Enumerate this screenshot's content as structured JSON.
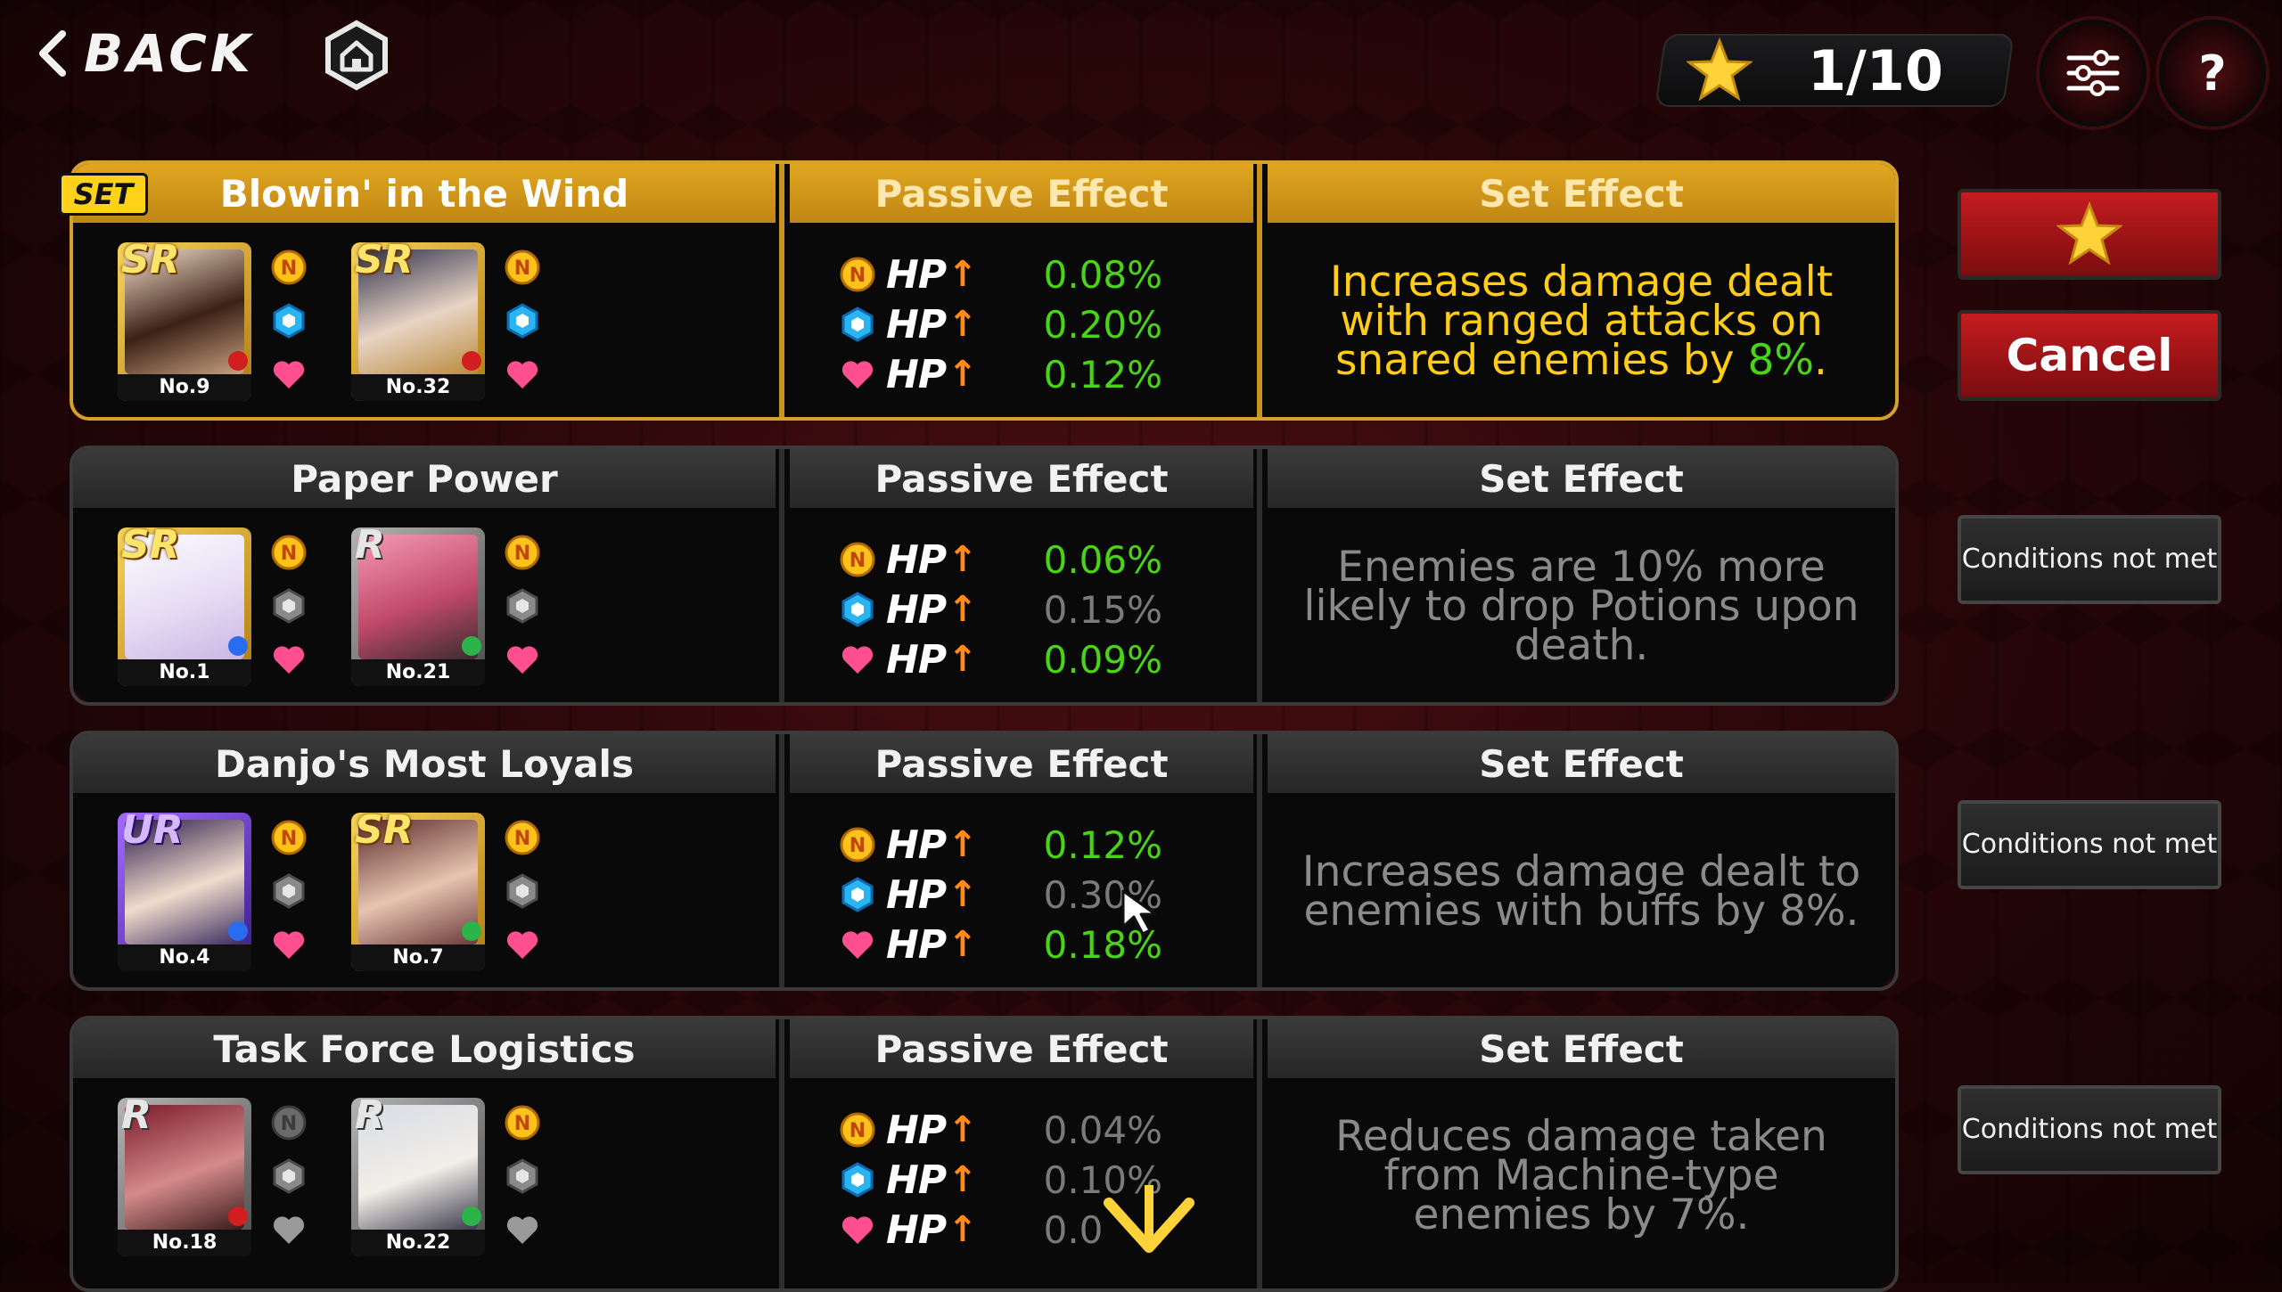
{
  "header": {
    "back_label": "BACK",
    "star_count": "1/10"
  },
  "side": {
    "cancel_label": "Cancel",
    "conditions_label": "Conditions not met"
  },
  "colors": {
    "accent_gold": "#d4a12a",
    "value_green": "#4ad418",
    "value_grey": "#7a7a7a",
    "button_red": "#c51c20"
  },
  "sets": [
    {
      "name": "Blowin' in the Wind",
      "badge": "SET",
      "active": true,
      "passive_header": "Passive Effect",
      "set_effect_header": "Set Effect",
      "cards": [
        {
          "rarity": "SR",
          "no": "No.9",
          "icons": [
            "n-icon",
            "hex-icon-blue",
            "heart-icon"
          ]
        },
        {
          "rarity": "SR",
          "no": "No.32",
          "icons": [
            "n-icon",
            "hex-icon-blue",
            "heart-icon"
          ]
        }
      ],
      "passive": [
        {
          "stat": "HP",
          "value": "0.08%",
          "met": true
        },
        {
          "stat": "HP",
          "value": "0.20%",
          "met": true
        },
        {
          "stat": "HP",
          "value": "0.12%",
          "met": true
        }
      ],
      "effect_pre": "Increases damage dealt with ranged attacks on snared enemies by ",
      "effect_hl": "8%",
      "effect_post": "."
    },
    {
      "name": "Paper Power",
      "active": false,
      "passive_header": "Passive Effect",
      "set_effect_header": "Set Effect",
      "cards": [
        {
          "rarity": "SR",
          "no": "No.1"
        },
        {
          "rarity": "R",
          "no": "No.21"
        }
      ],
      "passive": [
        {
          "stat": "HP",
          "value": "0.06%",
          "met": true
        },
        {
          "stat": "HP",
          "value": "0.15%",
          "met": false
        },
        {
          "stat": "HP",
          "value": "0.09%",
          "met": true
        }
      ],
      "effect": "Enemies are 10% more likely to drop Potions upon death."
    },
    {
      "name": "Danjo's Most Loyals",
      "active": false,
      "passive_header": "Passive Effect",
      "set_effect_header": "Set Effect",
      "cards": [
        {
          "rarity": "UR",
          "no": "No.4"
        },
        {
          "rarity": "SR",
          "no": "No.7"
        }
      ],
      "passive": [
        {
          "stat": "HP",
          "value": "0.12%",
          "met": true
        },
        {
          "stat": "HP",
          "value": "0.30%",
          "met": false
        },
        {
          "stat": "HP",
          "value": "0.18%",
          "met": true
        }
      ],
      "effect": "Increases damage dealt to enemies with buffs by 8%."
    },
    {
      "name": "Task Force Logistics",
      "active": false,
      "passive_header": "Passive Effect",
      "set_effect_header": "Set Effect",
      "cards": [
        {
          "rarity": "R",
          "no": "No.18"
        },
        {
          "rarity": "R",
          "no": "No.22"
        }
      ],
      "passive": [
        {
          "stat": "HP",
          "value": "0.04%",
          "met": false
        },
        {
          "stat": "HP",
          "value": "0.10%",
          "met": false
        },
        {
          "stat": "HP",
          "value": "0.0",
          "met": false
        }
      ],
      "effect": "Reduces damage taken from Machine-type enemies by 7%."
    }
  ]
}
